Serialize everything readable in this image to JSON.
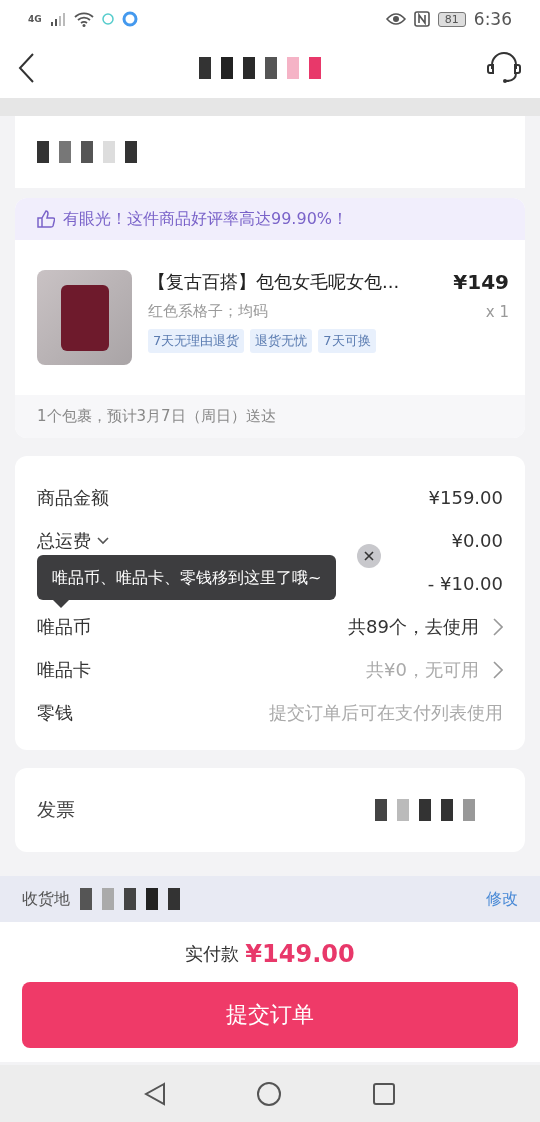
{
  "status_bar": {
    "network": "4G",
    "battery": "81",
    "time": "6:36"
  },
  "praise_banner": {
    "text": "有眼光！这件商品好评率高达99.90%！"
  },
  "product": {
    "title": "【复古百搭】包包女毛呢女包...",
    "price": "¥149",
    "spec": "红色系格子；均码",
    "quantity": "x 1",
    "tags": [
      "7天无理由退货",
      "退货无忧",
      "7天可换"
    ],
    "delivery": "1个包裹，预计3月7日（周日）送达"
  },
  "summary": [
    {
      "kind": "amount",
      "label": "商品金额",
      "value": "¥159.00"
    },
    {
      "kind": "dropdown",
      "label": "总运费",
      "value": "¥0.00"
    },
    {
      "kind": "amount",
      "value": "- ¥10.00"
    },
    {
      "kind": "link",
      "label": "唯品币",
      "value": "共89个，去使用",
      "disabled": false
    },
    {
      "kind": "link",
      "label": "唯品卡",
      "value": "共¥0，无可用",
      "disabled": true
    },
    {
      "kind": "note",
      "label": "零钱",
      "value": "提交订单后可在支付列表使用"
    }
  ],
  "tooltip": {
    "text": "唯品币、唯品卡、零钱移到这里了哦~"
  },
  "invoice": {
    "label": "发票"
  },
  "address_bar": {
    "label": "收货地",
    "edit": "修改"
  },
  "total": {
    "label": "实付款",
    "amount": "¥149.00"
  },
  "submit_button": "提交订单"
}
